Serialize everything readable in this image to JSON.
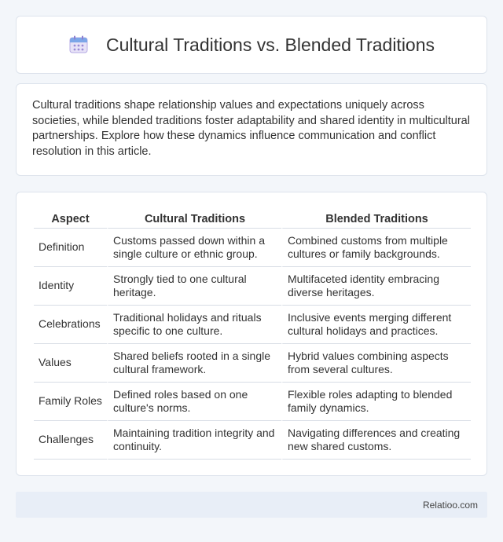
{
  "header": {
    "title": "Cultural Traditions vs. Blended Traditions",
    "icon": "calendar-icon"
  },
  "intro": {
    "text": "Cultural traditions shape relationship values and expectations uniquely across societies, while blended traditions foster adaptability and shared identity in multicultural partnerships. Explore how these dynamics influence communication and conflict resolution in this article."
  },
  "table": {
    "headers": [
      "Aspect",
      "Cultural Traditions",
      "Blended Traditions"
    ],
    "rows": [
      [
        "Definition",
        "Customs passed down within a single culture or ethnic group.",
        "Combined customs from multiple cultures or family backgrounds."
      ],
      [
        "Identity",
        "Strongly tied to one cultural heritage.",
        "Multifaceted identity embracing diverse heritages."
      ],
      [
        "Celebrations",
        "Traditional holidays and rituals specific to one culture.",
        "Inclusive events merging different cultural holidays and practices."
      ],
      [
        "Values",
        "Shared beliefs rooted in a single cultural framework.",
        "Hybrid values combining aspects from several cultures."
      ],
      [
        "Family Roles",
        "Defined roles based on one culture's norms.",
        "Flexible roles adapting to blended family dynamics."
      ],
      [
        "Challenges",
        "Maintaining tradition integrity and continuity.",
        "Navigating differences and creating new shared customs."
      ]
    ]
  },
  "footer": {
    "text": "Relatioo.com"
  },
  "colors": {
    "background": "#f3f6fa",
    "card": "#ffffff",
    "footer": "#e8eef7",
    "icon_accent": "#9b8bd6"
  }
}
